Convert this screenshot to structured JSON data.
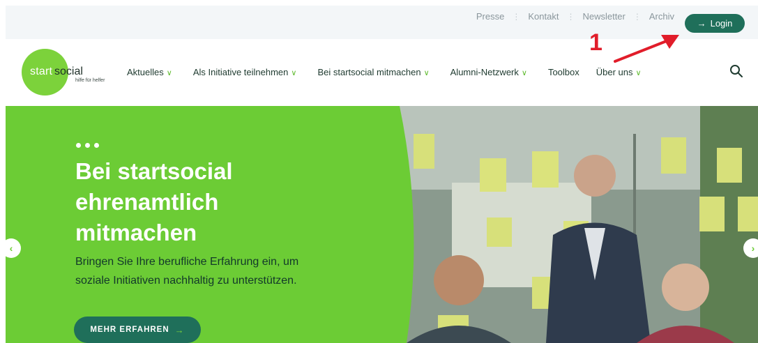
{
  "topbar": {
    "links": [
      "Presse",
      "Kontakt",
      "Newsletter",
      "Archiv"
    ],
    "login_label": "Login",
    "login_icon": "arrow-right-icon"
  },
  "annotation": {
    "number": "1",
    "color": "#e11d2a"
  },
  "logo": {
    "part1": "start",
    "part2": "social",
    "tagline": "hilfe für helfer"
  },
  "nav": {
    "items": [
      {
        "label": "Aktuelles",
        "dropdown": true
      },
      {
        "label": "Als Initiative teilnehmen",
        "dropdown": true
      },
      {
        "label": "Bei startsocial mitmachen",
        "dropdown": true
      },
      {
        "label": "Alumni-Netzwerk",
        "dropdown": true
      },
      {
        "label": "Toolbox",
        "dropdown": false
      },
      {
        "label": "Über uns",
        "dropdown": true
      }
    ],
    "search_icon": "search-icon"
  },
  "hero": {
    "headline_lines": [
      "Bei startsocial",
      "ehrenamtlich",
      "mitmachen"
    ],
    "subtext_lines": [
      "Bringen Sie Ihre berufliche Erfahrung ein, um",
      "soziale Initiativen nachhaltig zu unterstützen."
    ],
    "cta_label": "MEHR ERFAHREN",
    "cta_icon": "arrow-right-icon",
    "prev_icon": "chevron-left-icon",
    "next_icon": "chevron-right-icon"
  },
  "colors": {
    "brand_green": "#6ccc35",
    "dark_green": "#1f6f5a",
    "logo_green": "#7cd23b"
  }
}
